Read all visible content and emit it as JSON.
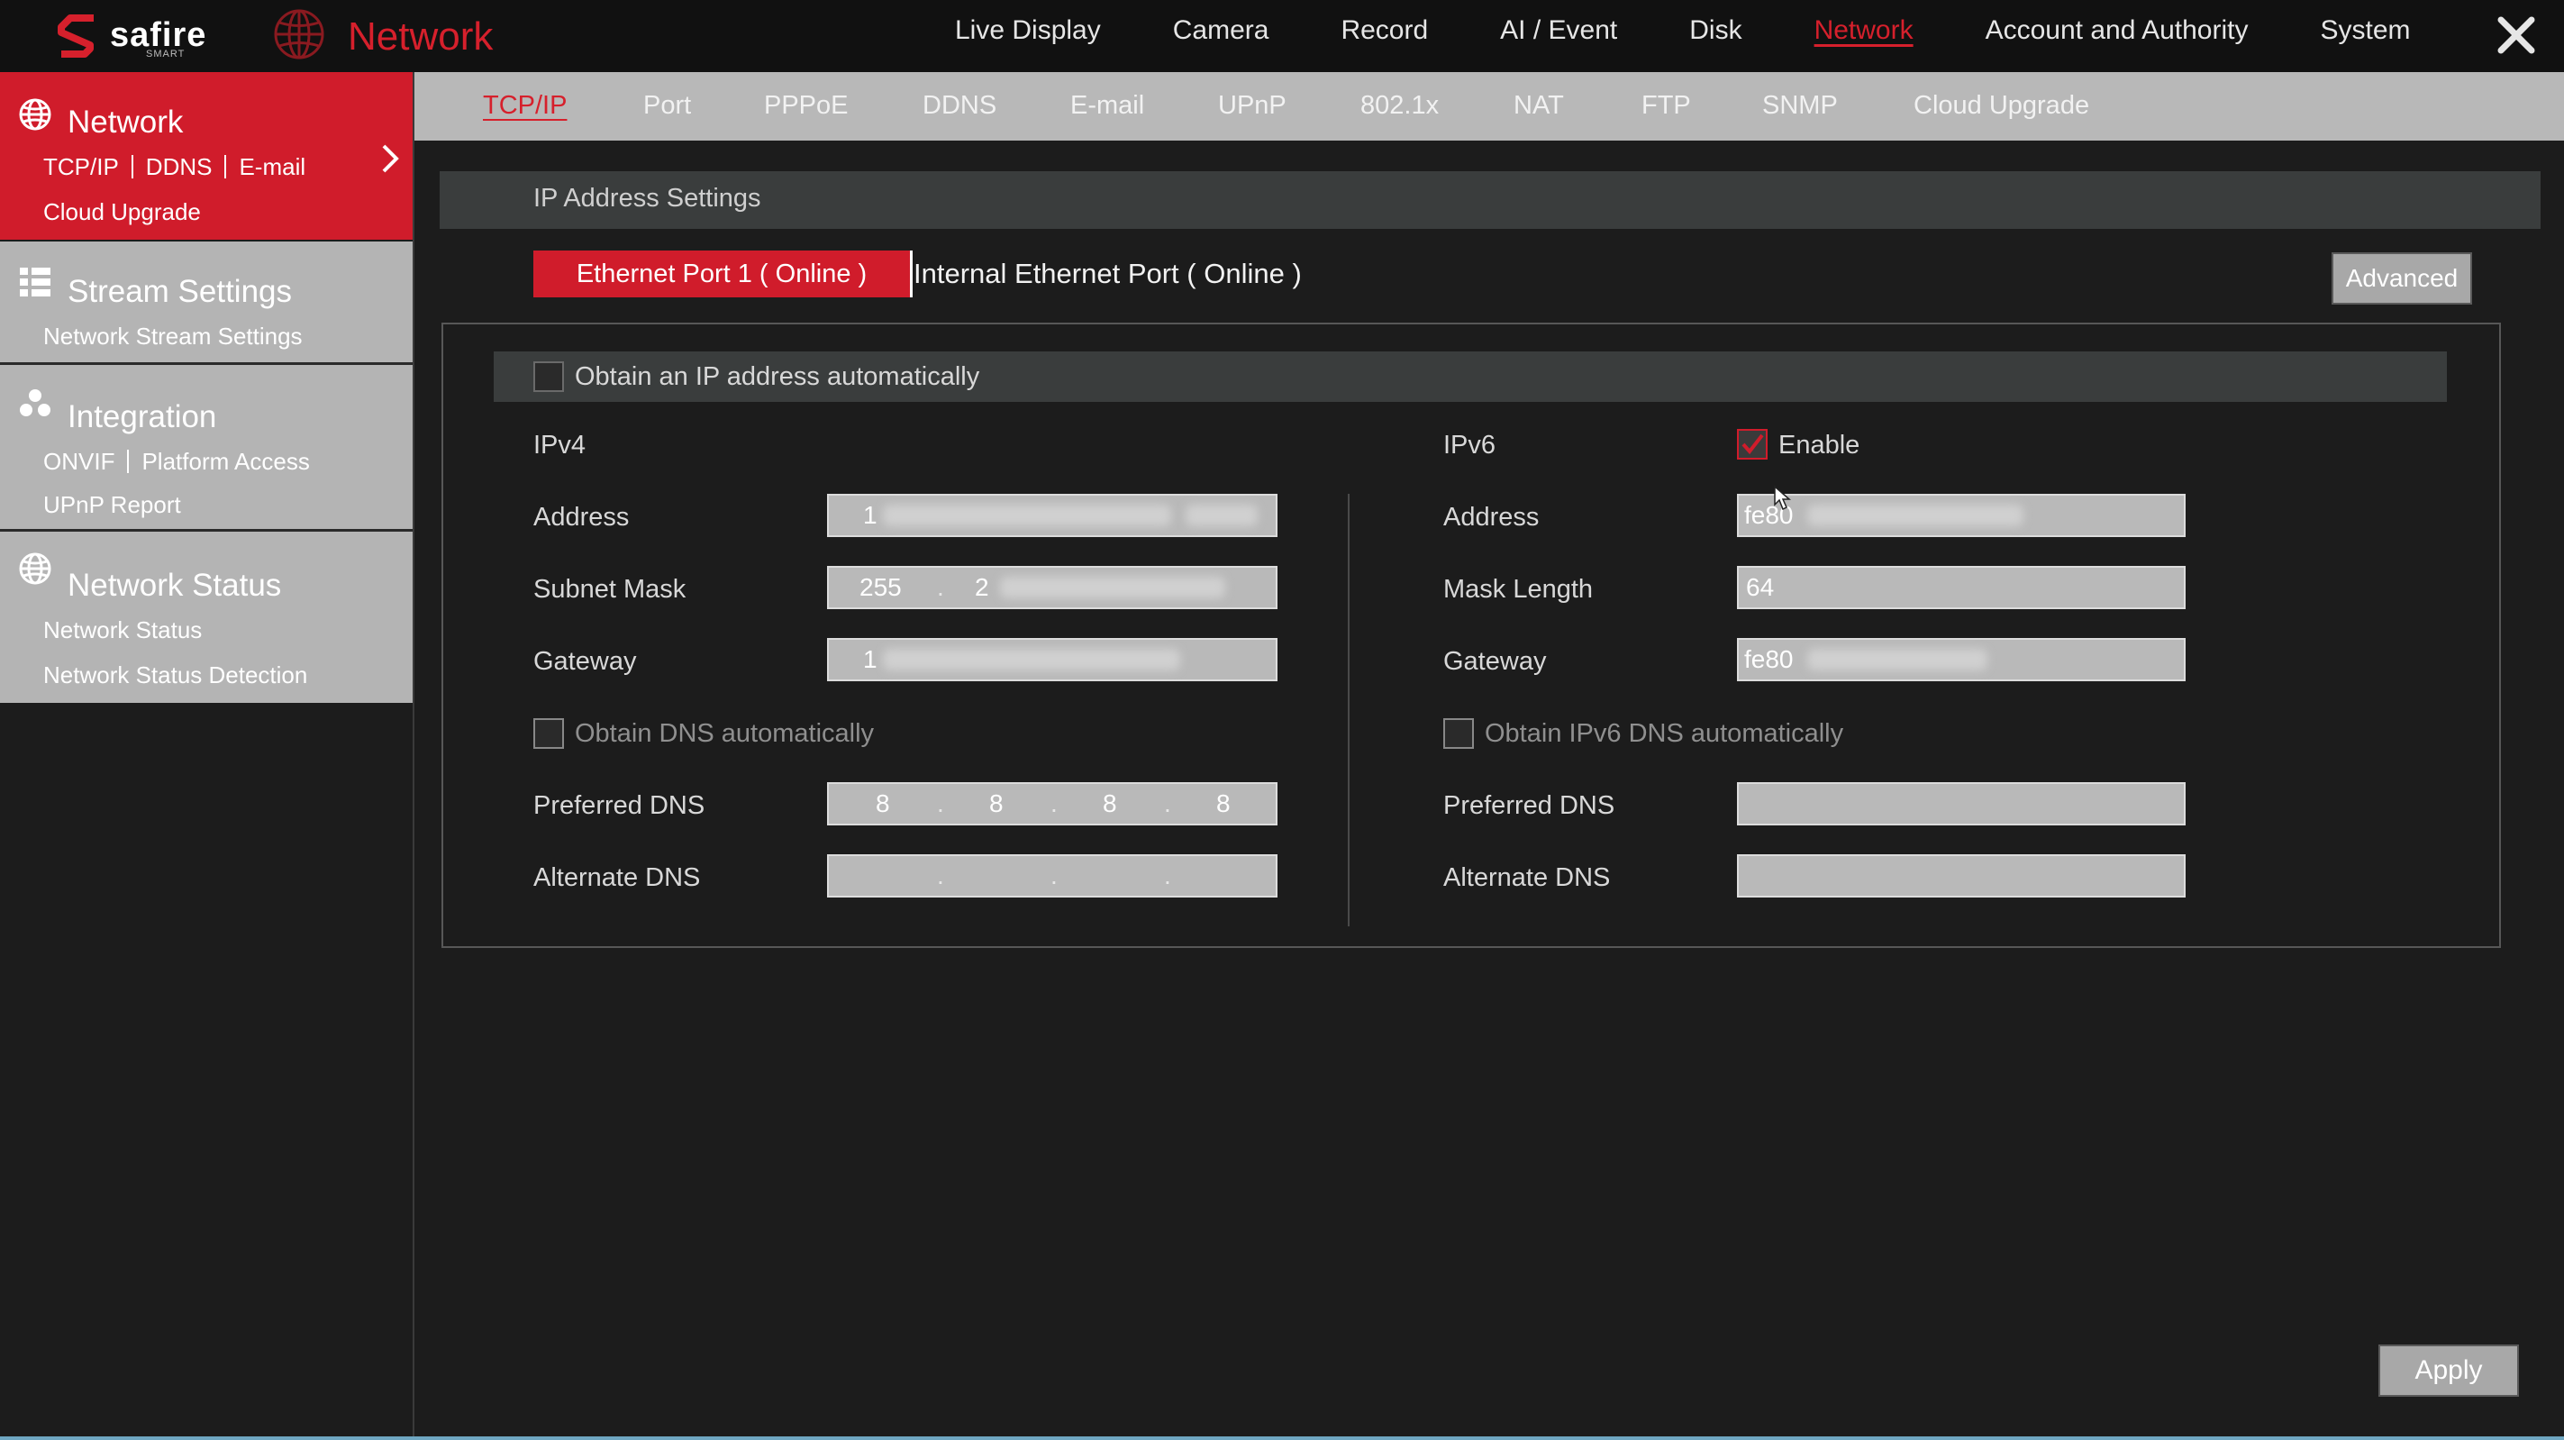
{
  "app": {
    "brand": "safire",
    "brand_sub": "SMART",
    "page_title": "Network"
  },
  "top_menu": [
    "Live Display",
    "Camera",
    "Record",
    "AI / Event",
    "Disk",
    "Network",
    "Account and Authority",
    "System"
  ],
  "top_menu_active": "Network",
  "sidebar": {
    "network": {
      "title": "Network",
      "sub1": "TCP/IP",
      "sub2": "DDNS",
      "sub3": "E-mail",
      "sub4": "Cloud Upgrade"
    },
    "stream": {
      "title": "Stream Settings",
      "sub1": "Network Stream Settings"
    },
    "integration": {
      "title": "Integration",
      "sub1": "ONVIF",
      "sub2": "Platform Access",
      "sub3": "UPnP Report"
    },
    "status": {
      "title": "Network Status",
      "sub1": "Network Status",
      "sub2": "Network Status Detection"
    }
  },
  "subtabs": [
    "TCP/IP",
    "Port",
    "PPPoE",
    "DDNS",
    "E-mail",
    "UPnP",
    "802.1x",
    "NAT",
    "FTP",
    "SNMP",
    "Cloud Upgrade"
  ],
  "section_title": "IP Address Settings",
  "port_tabs": {
    "active": "Ethernet Port 1 ( Online )",
    "other": "Internal Ethernet Port ( Online )"
  },
  "advanced_label": "Advanced",
  "obtain_ip_auto": {
    "label": "Obtain an IP address automatically",
    "checked": false
  },
  "ipv4": {
    "heading": "IPv4",
    "address_label": "Address",
    "address_first": "1",
    "subnet_label": "Subnet Mask",
    "subnet_first": "255",
    "subnet_second": "2",
    "gateway_label": "Gateway",
    "gateway_first": "1",
    "obtain_dns_label": "Obtain DNS automatically",
    "preferred_dns_label": "Preferred DNS",
    "preferred_dns": [
      "8",
      "8",
      "8",
      "8"
    ],
    "alternate_dns_label": "Alternate DNS"
  },
  "ipv6": {
    "heading": "IPv6",
    "enable_label": "Enable",
    "enabled": true,
    "address_label": "Address",
    "address_prefix": "fe80",
    "mask_label": "Mask Length",
    "mask_value": "64",
    "gateway_label": "Gateway",
    "gateway_prefix": "fe80",
    "obtain_dns_label": "Obtain IPv6 DNS automatically",
    "preferred_dns_label": "Preferred DNS",
    "alternate_dns_label": "Alternate DNS"
  },
  "apply_label": "Apply",
  "colors": {
    "accent": "#d01c2b",
    "bg": "#1c1c1c",
    "sidebar_group": "#b4b4b4",
    "field": "#b9b9b9"
  }
}
